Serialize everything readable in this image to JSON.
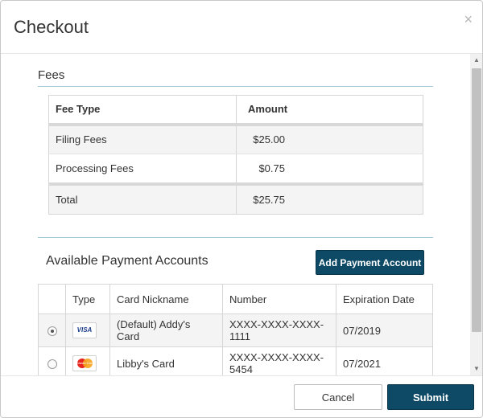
{
  "dialog": {
    "title": "Checkout",
    "close_glyph": "×"
  },
  "fees": {
    "section_title": "Fees",
    "headers": {
      "type": "Fee Type",
      "amount": "Amount"
    },
    "rows": [
      {
        "type": "Filing Fees",
        "amount": "$25.00"
      },
      {
        "type": "Processing Fees",
        "amount": "$0.75"
      }
    ],
    "total": {
      "label": "Total",
      "amount": "$25.75"
    }
  },
  "accounts": {
    "section_title": "Available Payment Accounts",
    "add_button_label": "Add Payment Account",
    "headers": {
      "select": "",
      "type": "Type",
      "nickname": "Card Nickname",
      "number": "Number",
      "expiration": "Expiration Date"
    },
    "rows": [
      {
        "selected": true,
        "card_icon": "visa-card-icon",
        "card_icon_text": "VISA",
        "nickname": "(Default) Addy's Card",
        "number": "XXXX-XXXX-XXXX-1111",
        "expiration": "07/2019"
      },
      {
        "selected": false,
        "card_icon": "mastercard-card-icon",
        "card_icon_text": "MasterCard",
        "nickname": "Libby's Card",
        "number": "XXXX-XXXX-XXXX-5454",
        "expiration": "07/2021"
      }
    ]
  },
  "footer": {
    "cancel_label": "Cancel",
    "submit_label": "Submit"
  },
  "colors": {
    "primary_button": "#0e4a66",
    "section_rule": "#9fc7d4"
  }
}
